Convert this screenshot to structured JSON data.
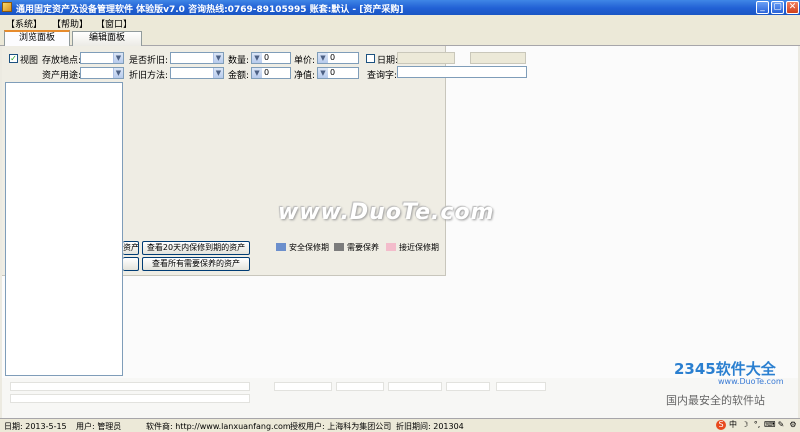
{
  "window": {
    "title": "通用固定资产及设备管理软件 体验版v7.0 咨询热线:0769-89105995 账套:默认 - [资产采购]",
    "controls": {
      "minimize": "_",
      "restore": "▢",
      "close": "✕"
    }
  },
  "menu": [
    "【系统】",
    "【帮助】",
    "【窗口】"
  ],
  "tabs": [
    {
      "label": "浏览面板",
      "active": true
    },
    {
      "label": "编辑面板",
      "active": false
    }
  ],
  "filters": {
    "view_label": "视图",
    "location_label": "存放地点:",
    "usage_label": "资产用途:",
    "depreciation_label": "是否折旧:",
    "method_label": "折旧方法:",
    "quantity_label": "数量:",
    "quantity_value": "0",
    "amount_label": "金额:",
    "amount_value": "0",
    "price_label": "单价:",
    "price_value": "0",
    "net_label": "净值:",
    "net_value": "0",
    "date_label": "日期:",
    "search_label": "查询字:",
    "search_value": ""
  },
  "buttons": {
    "partial_left_top": "资产",
    "within_20_days": "查看20天内保修到期的资产",
    "partial_left_bottom": "",
    "needs_maintenance": "查看所有需要保养的资产"
  },
  "legend": [
    {
      "label": "安全保修期",
      "color": "#6c8fcc"
    },
    {
      "label": "需要保养",
      "color": "#7c7c7c"
    },
    {
      "label": "接近保修期",
      "color": "#f3bccb"
    }
  ],
  "watermark": "www.DuoTe.com",
  "brand": {
    "name": "2345软件大全",
    "url": "www.DuoTe.com",
    "slogan": "国内最安全的软件站"
  },
  "status": {
    "date": "日期: 2013-5-15",
    "user": "用户: 管理员",
    "vendor": "软件商: http://www.lanxuanfang.com",
    "licensee": "授权用户: 上海科为集团公司",
    "period": "折旧期间: 201304"
  },
  "tray_icons": [
    "s-icon",
    "中",
    "☽",
    "°,",
    "⌨",
    "✎",
    "⚙"
  ]
}
